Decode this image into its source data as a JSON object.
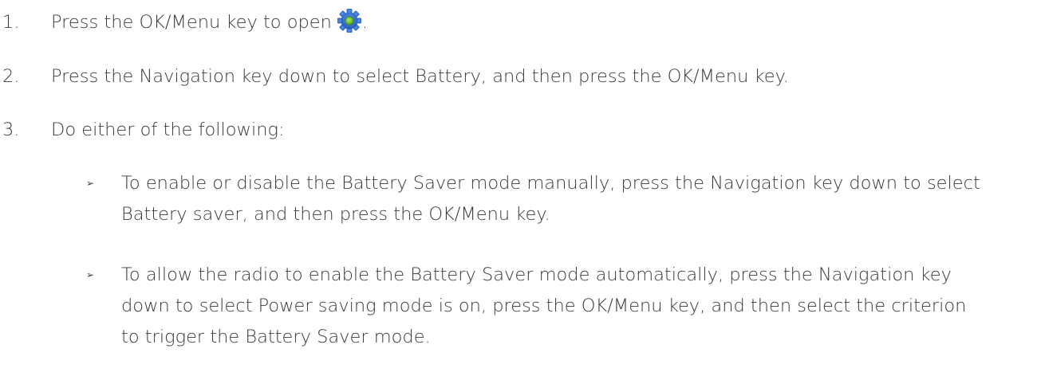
{
  "steps": [
    {
      "number": "1.",
      "text": "Press the OK/Menu key to open",
      "suffix": "."
    },
    {
      "number": "2.",
      "text": "Press the Navigation key down to select Battery, and then press the OK/Menu key."
    },
    {
      "number": "3.",
      "text": "Do either of the following:"
    }
  ],
  "bullet_glyph": "➢",
  "bullets": [
    {
      "lines": [
        "To enable or disable the Battery Saver mode manually, press the Navigation key down to select",
        "Battery saver, and then press the OK/Menu key."
      ]
    },
    {
      "lines": [
        "To allow the radio to enable the Battery Saver mode automatically, press the Navigation key",
        "down to select Power saving mode is on, press the OK/Menu key, and then select the criterion",
        "to trigger the Battery Saver mode."
      ]
    }
  ],
  "icons": {
    "settings": "gear-icon"
  },
  "colors": {
    "text": "#3a3a3a",
    "gear": "#2d6fd6",
    "gear_center": "#6cc83c"
  }
}
